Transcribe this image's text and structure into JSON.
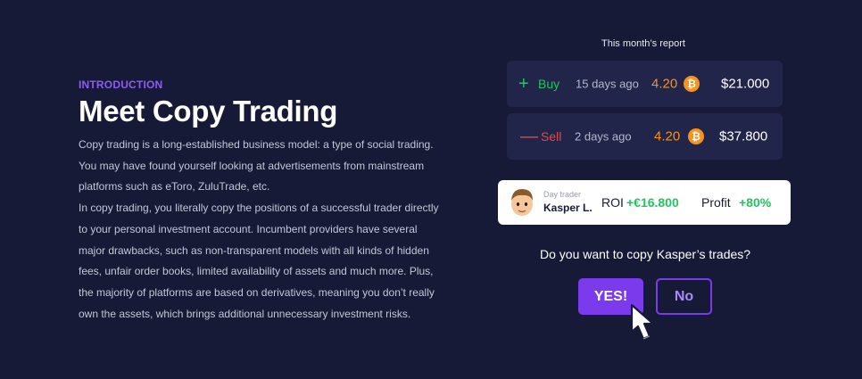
{
  "intro": {
    "eyebrow": "INTRODUCTION",
    "title": "Meet Copy Trading",
    "paragraph_1": "Copy trading is a long-established business model: a type of social trading. You may have found yourself looking at advertisements from mainstream platforms such as eToro, ZuluTrade, etc.",
    "paragraph_2": "In copy trading, you literally copy the positions of a successful trader directly to your personal investment account. Incumbent providers have several major drawbacks, such as non-transparent models with all kinds of hidden fees, unfair order books, limited availability of assets and much more. Plus, the majority of platforms are based on derivatives, meaning you don’t really own the assets, which brings additional unnecessary investment risks."
  },
  "report": {
    "label": "This month’s report",
    "trades": [
      {
        "sign": "+",
        "type": "Buy",
        "ago": "15 days ago",
        "amount": "4.20",
        "coin": "₿",
        "price": "$21.000"
      },
      {
        "sign": "—",
        "type": "Sell",
        "ago": "2 days ago",
        "amount": "4.20",
        "coin": "₿",
        "price": "$37.800"
      }
    ]
  },
  "trader": {
    "role": "Day trader",
    "name": "Kasper L.",
    "roi_label": "ROI",
    "roi_value": "+€16.800",
    "profit_label": "Profit",
    "profit_value": "+80%"
  },
  "prompt": {
    "question": "Do you want to copy Kasper’s trades?",
    "yes_label": "YES!",
    "no_label": "No"
  },
  "colors": {
    "background": "#171a36",
    "card": "#21254a",
    "accent": "#7c3aed",
    "eyebrow": "#8b5cf6",
    "buy": "#22c55e",
    "sell": "#ef4444",
    "bitcoin": "#f7931a"
  },
  "icons": {
    "coin": "bitcoin-icon",
    "avatar": "trader-avatar",
    "pointer": "hand-pointer-icon"
  }
}
